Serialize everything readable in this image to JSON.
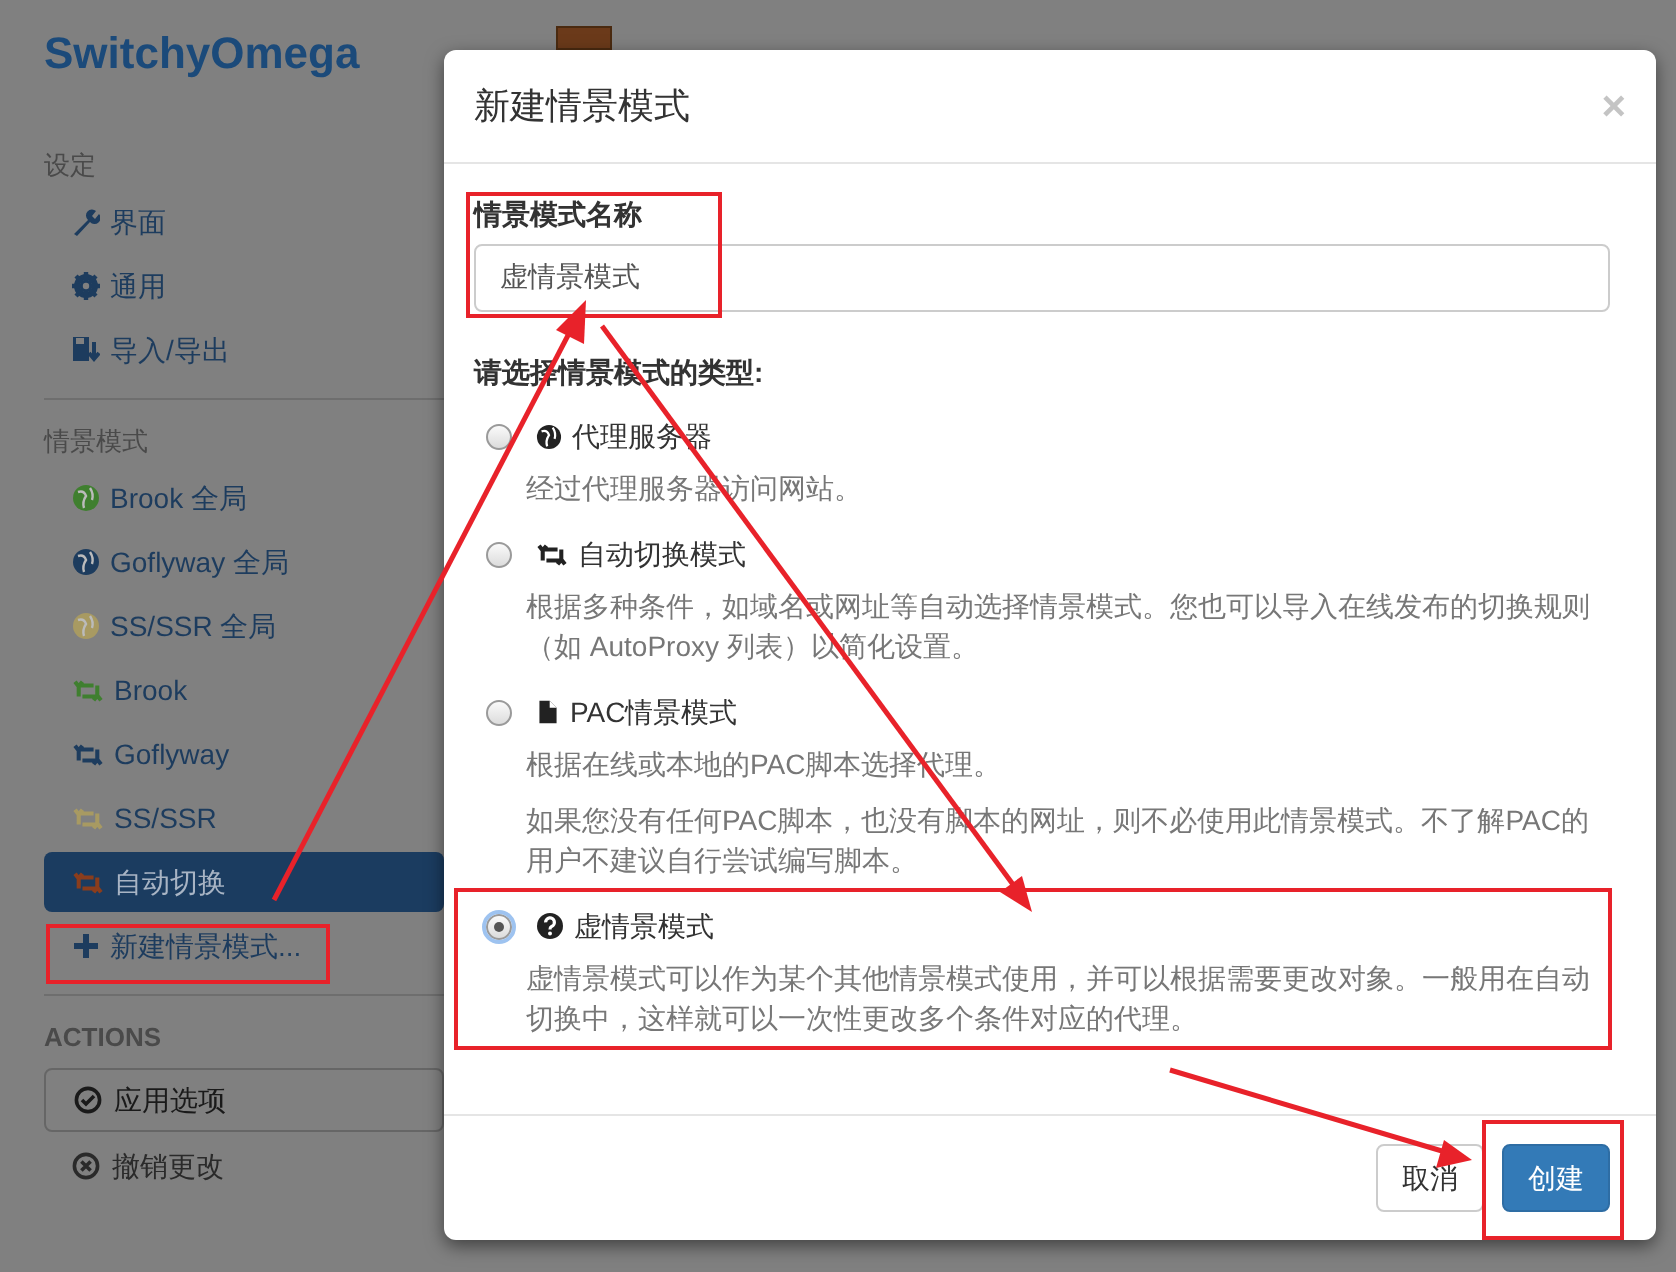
{
  "sidebar": {
    "title": "SwitchyOmega",
    "sections": [
      {
        "heading": "设定",
        "items": [
          {
            "label": "界面",
            "kind": "interface",
            "selected": false
          },
          {
            "label": "通用",
            "kind": "general",
            "selected": false
          },
          {
            "label": "导入/导出",
            "kind": "import-export",
            "selected": false
          }
        ]
      },
      {
        "heading": "情景模式",
        "items": [
          {
            "label": "Brook 全局",
            "kind": "proxy-profile",
            "color": "#3f7f2f",
            "selected": false
          },
          {
            "label": "Goflyway 全局",
            "kind": "proxy-profile",
            "color": "#1d3c5e",
            "selected": false
          },
          {
            "label": "SS/SSR 全局",
            "kind": "proxy-profile",
            "color": "#a89a62",
            "selected": false
          },
          {
            "label": "Brook",
            "kind": "switch-profile",
            "color": "#3f7f2f",
            "selected": false
          },
          {
            "label": "Goflyway",
            "kind": "switch-profile",
            "color": "#1d3c5e",
            "selected": false
          },
          {
            "label": "SS/SSR",
            "kind": "switch-profile",
            "color": "#a89a62",
            "selected": false
          },
          {
            "label": "自动切换",
            "kind": "switch-profile",
            "color": "#8b3d1c",
            "selected": true
          },
          {
            "label": "新建情景模式...",
            "kind": "new-profile",
            "selected": false
          }
        ]
      }
    ],
    "actions": {
      "heading": "ACTIONS",
      "items": [
        {
          "label": "应用选项",
          "kind": "apply"
        },
        {
          "label": "撤销更改",
          "kind": "discard"
        }
      ]
    }
  },
  "modal": {
    "title": "新建情景模式",
    "close": "×",
    "name_label": "情景模式名称",
    "name_value": "虚情景模式",
    "type_label": "请选择情景模式的类型:",
    "options": [
      {
        "kind": "proxy",
        "label": "代理服务器",
        "selected": false,
        "descriptions": [
          "经过代理服务器访问网站。"
        ]
      },
      {
        "kind": "switch",
        "label": "自动切换模式",
        "selected": false,
        "descriptions": [
          "根据多种条件，如域名或网址等自动选择情景模式。您也可以导入在线发布的切换规则（如 AutoProxy 列表）以简化设置。"
        ]
      },
      {
        "kind": "pac",
        "label": "PAC情景模式",
        "selected": false,
        "descriptions": [
          "根据在线或本地的PAC脚本选择代理。",
          "如果您没有任何PAC脚本，也没有脚本的网址，则不必使用此情景模式。不了解PAC的用户不建议自行尝试编写脚本。"
        ]
      },
      {
        "kind": "virtual",
        "label": "虚情景模式",
        "selected": true,
        "descriptions": [
          "虚情景模式可以作为某个其他情景模式使用，并可以根据需要更改对象。一般用在自动切换中，这样就可以一次性更改多个条件对应的代理。"
        ]
      }
    ],
    "buttons": [
      {
        "label": "取消",
        "kind": "default"
      },
      {
        "label": "创建",
        "kind": "primary"
      }
    ]
  }
}
